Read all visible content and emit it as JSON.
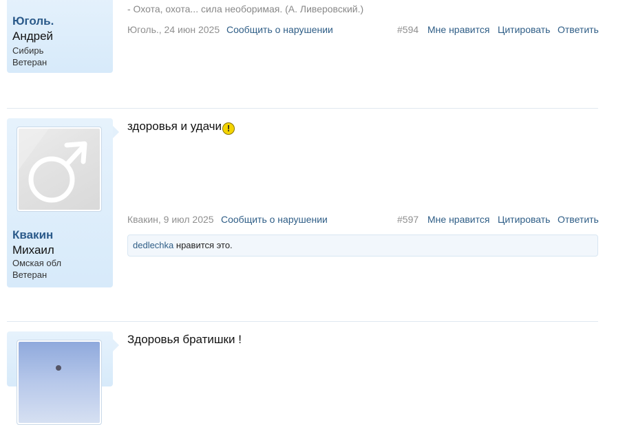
{
  "posts": [
    {
      "username": "Юголь.",
      "realname": "Андрей",
      "location": "Сибирь",
      "rank": "Ветеран",
      "quote_text": "- Охота, охота... сила необоримая. (А. Ливеровский.)",
      "author_date": "Юголь., 24 июн 2025",
      "report": "Сообщить о нарушении",
      "number": "#594",
      "like": "Мне нравится",
      "quote": "Цитировать",
      "reply": "Ответить"
    },
    {
      "username": "Квакин",
      "realname": "Михаил",
      "location": "Омская обл",
      "rank": "Ветеран",
      "avatar_icon": "male-symbol-icon",
      "message": "здоровья и удачи",
      "author_date": "Квакин, 9 июл 2025",
      "report": "Сообщить о нарушении",
      "number": "#597",
      "like": "Мне нравится",
      "quote": "Цитировать",
      "reply": "Ответить",
      "liked_by": "dedlechka",
      "liked_suffix": " нравится это."
    },
    {
      "message": "Здоровья братишки !"
    }
  ],
  "warning_glyph": "!",
  "colors": {
    "link": "#2e5d86",
    "username": "#2b5a8a",
    "muted": "#8f8f8f",
    "userblock": "#dbecfa"
  }
}
